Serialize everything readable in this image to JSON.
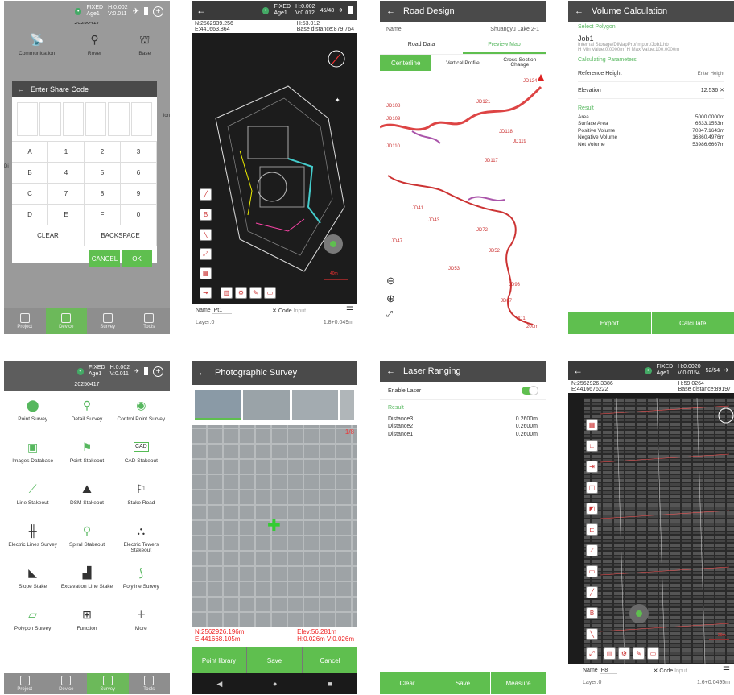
{
  "status": {
    "fix": "FIXED",
    "h1": "H:0.002",
    "v1": "V:0.011",
    "sats1": "45/48",
    "age": "Age1",
    "pct": "84%",
    "date": "20250417"
  },
  "p1": {
    "tools": [
      "Communication",
      "Rover",
      "Base"
    ],
    "dialog_title": "Enter Share Code",
    "side_peek_1": "ion",
    "side_peek_2": "Di",
    "keys": [
      "A",
      "1",
      "2",
      "3",
      "B",
      "4",
      "5",
      "6",
      "C",
      "7",
      "8",
      "9",
      "D",
      "E",
      "F",
      "0"
    ],
    "clear": "CLEAR",
    "backspace": "BACKSPACE",
    "cancel": "CANCEL",
    "ok": "OK",
    "nav": [
      "Project",
      "Device",
      "Survey",
      "Tools"
    ]
  },
  "p2": {
    "n": "N:2562939.256",
    "e": "E:441663.864",
    "h": "H:53.012",
    "base": "Base distance:879.764",
    "name_label": "Name",
    "name_val": "Pt1",
    "code_label": "Code",
    "code_ph": "Input",
    "layer": "Layer:0",
    "pole": "1.8+0.049m",
    "scale": "40m",
    "status": {
      "h": "H:0.002",
      "v": "V:0.012",
      "sats": "45/48",
      "age": "Age1",
      "pct": "84%"
    }
  },
  "p3": {
    "title": "Road Design",
    "name_label": "Name",
    "name_val": "Shuangyu Lake 2-1",
    "tabs": [
      "Road Data",
      "Preview Map"
    ],
    "subtabs": [
      "Centerline",
      "Vertical Profile",
      "Cross-Section Change"
    ],
    "jd": [
      "JD124",
      "JD121",
      "JD118",
      "JD119",
      "JD117",
      "JD108",
      "JD109",
      "JD110",
      "JD47",
      "JD53",
      "JD52",
      "JD43",
      "JD41",
      "JD87",
      "JD93",
      "JD72",
      "JD1"
    ],
    "scale": "200m"
  },
  "p4": {
    "title": "Volume Calculation",
    "select_polygon": "Select Polygon",
    "job": "Job1",
    "path": "Internal Storage/DiMapPro/Import/Job1.hb",
    "hmin": "H Min Value:0.0000m",
    "hmax": "H Max Value:100.0000m",
    "calc_params": "Calculating Parameters",
    "ref_label": "Reference Height",
    "ref_val": "Enter Height",
    "elev_label": "Elevation",
    "elev_val": "12.536",
    "result": "Result",
    "results": [
      {
        "k": "Area",
        "v": "5000.0000m"
      },
      {
        "k": "Surface Area",
        "v": "6533.1553m"
      },
      {
        "k": "Positive Volume",
        "v": "70347.1643m"
      },
      {
        "k": "Negative Volume",
        "v": "16360.4976m"
      },
      {
        "k": "Net Volume",
        "v": "53986.6667m"
      }
    ],
    "export": "Export",
    "calculate": "Calculate"
  },
  "p5": {
    "items": [
      "Point Survey",
      "Detail Survey",
      "Control Point Survey",
      "Images Database",
      "Point Stakeout",
      "CAD Stakeout",
      "Line Stakeout",
      "DSM Stakeout",
      "Stake Road",
      "Electric Lines Survey",
      "Spiral Stakeout",
      "Electric Towers Stakeout",
      "Slope Stake",
      "Excavation Line Stake",
      "Polyline Survey",
      "Polygon Survey",
      "Function",
      "More"
    ],
    "cad": "CAD"
  },
  "p6": {
    "title": "Photographic Survey",
    "n": "N:2562926.196m",
    "e": "E:441668.105m",
    "elev": "Elev:56.281m",
    "hv": "H:0.026m V:0.026m",
    "btns": [
      "Point library",
      "Save",
      "Cancel"
    ],
    "counter": "1/8"
  },
  "p7": {
    "title": "Laser Ranging",
    "enable": "Enable Laser",
    "result": "Result",
    "rows": [
      {
        "k": "Distance3",
        "v": "0.2600m"
      },
      {
        "k": "Distance2",
        "v": "0.2600m"
      },
      {
        "k": "Distance1",
        "v": "0.2600m"
      }
    ],
    "btns": [
      "Clear",
      "Save",
      "Measure"
    ]
  },
  "p8": {
    "n": "N:2562926.3386",
    "e": "E:4416676222",
    "h": "H:59.0264",
    "base": "Base distance:89197",
    "name_label": "Name",
    "name_val": "P8",
    "code_label": "Code",
    "code_ph": "Input",
    "layer": "Layer:0",
    "pole": "1.6+0.0495m",
    "scale": "20m",
    "status": {
      "h": "H:0.0020",
      "v": "V:0.0154",
      "sats": "52/54",
      "age": "Age1"
    }
  }
}
